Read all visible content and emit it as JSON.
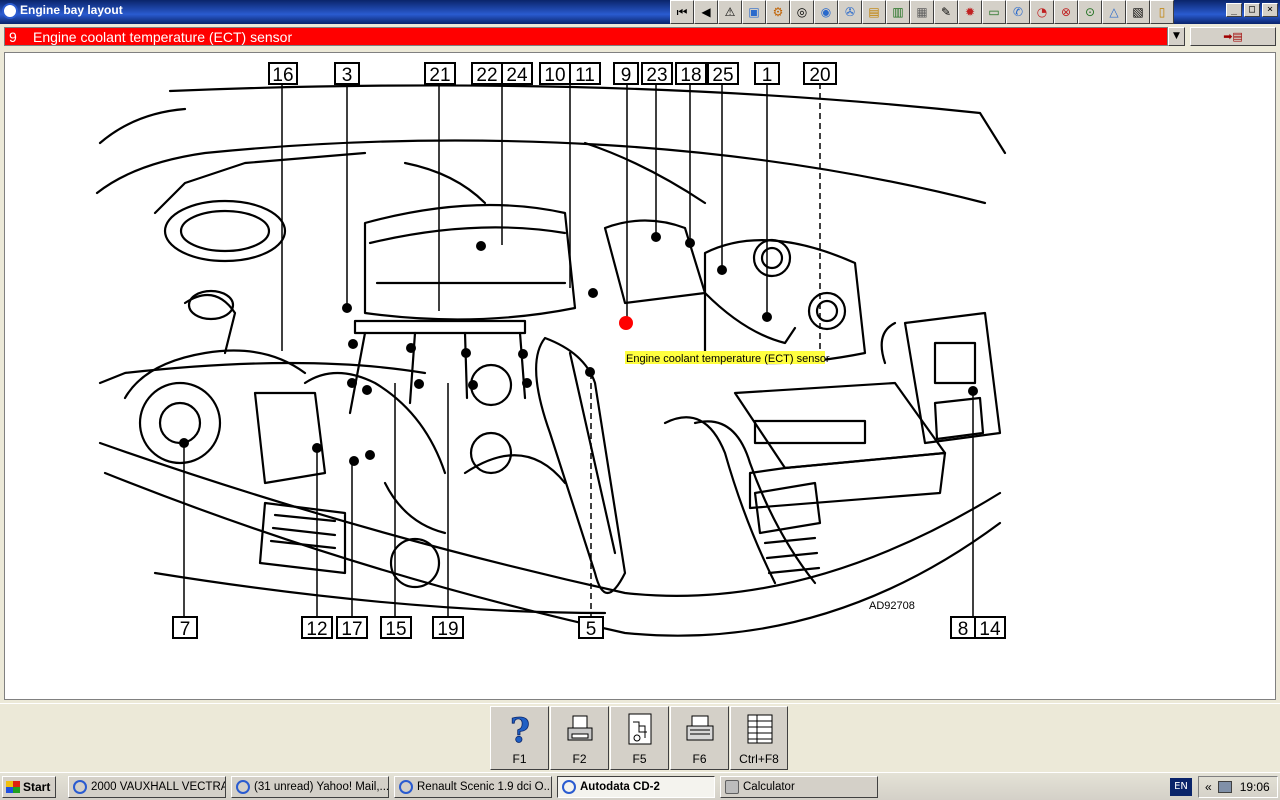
{
  "window": {
    "title": "Engine bay layout",
    "controls": [
      "_",
      "□",
      "×"
    ]
  },
  "toolbar": {
    "icons": [
      "first-page-icon",
      "previous-icon",
      "warning-icon",
      "picture-icon",
      "gear-icon",
      "wheel-icon",
      "tyre-icon",
      "tools-icon",
      "battery-icon",
      "ecu-icon",
      "engine-icon",
      "wiring-icon",
      "spark-icon",
      "belt-icon",
      "help-icon",
      "tachometer-icon",
      "brake-icon",
      "service-icon",
      "warning-triangle-icon",
      "document-icon",
      "clipboard-icon"
    ]
  },
  "selector": {
    "number": "9",
    "label": "Engine coolant temperature (ECT) sensor",
    "bg_color": "#ff0000"
  },
  "export_button": {
    "glyph": "➡▤"
  },
  "diagram": {
    "reference": "AD92708",
    "tooltip": "Engine coolant temperature (ECT) sensor",
    "highlight_color": "#ff0000",
    "top_callouts": [
      "16",
      "3",
      "21",
      "22",
      "24",
      "10",
      "11",
      "9",
      "23",
      "18",
      "25",
      "1",
      "20"
    ],
    "bottom_callouts": [
      "7",
      "12",
      "17",
      "15",
      "19",
      "5",
      "8",
      "14"
    ]
  },
  "function_keys": [
    {
      "label": "F1",
      "icon": "help-icon"
    },
    {
      "label": "F2",
      "icon": "printer-icon"
    },
    {
      "label": "F5",
      "icon": "diagram-icon"
    },
    {
      "label": "F6",
      "icon": "print-preview-icon"
    },
    {
      "label": "Ctrl+F8",
      "icon": "table-icon"
    }
  ],
  "taskbar": {
    "start_label": "Start",
    "tasks": [
      {
        "label": "2000 VAUXHALL VECTRA...",
        "active": false
      },
      {
        "label": "(31 unread) Yahoo! Mail,...",
        "active": false
      },
      {
        "label": "Renault Scenic 1.9 dci O...",
        "active": false
      },
      {
        "label": "Autodata CD-2",
        "active": true
      },
      {
        "label": "Calculator",
        "active": false
      }
    ],
    "language": "EN",
    "tray_chevron": "«",
    "clock": "19:06"
  }
}
